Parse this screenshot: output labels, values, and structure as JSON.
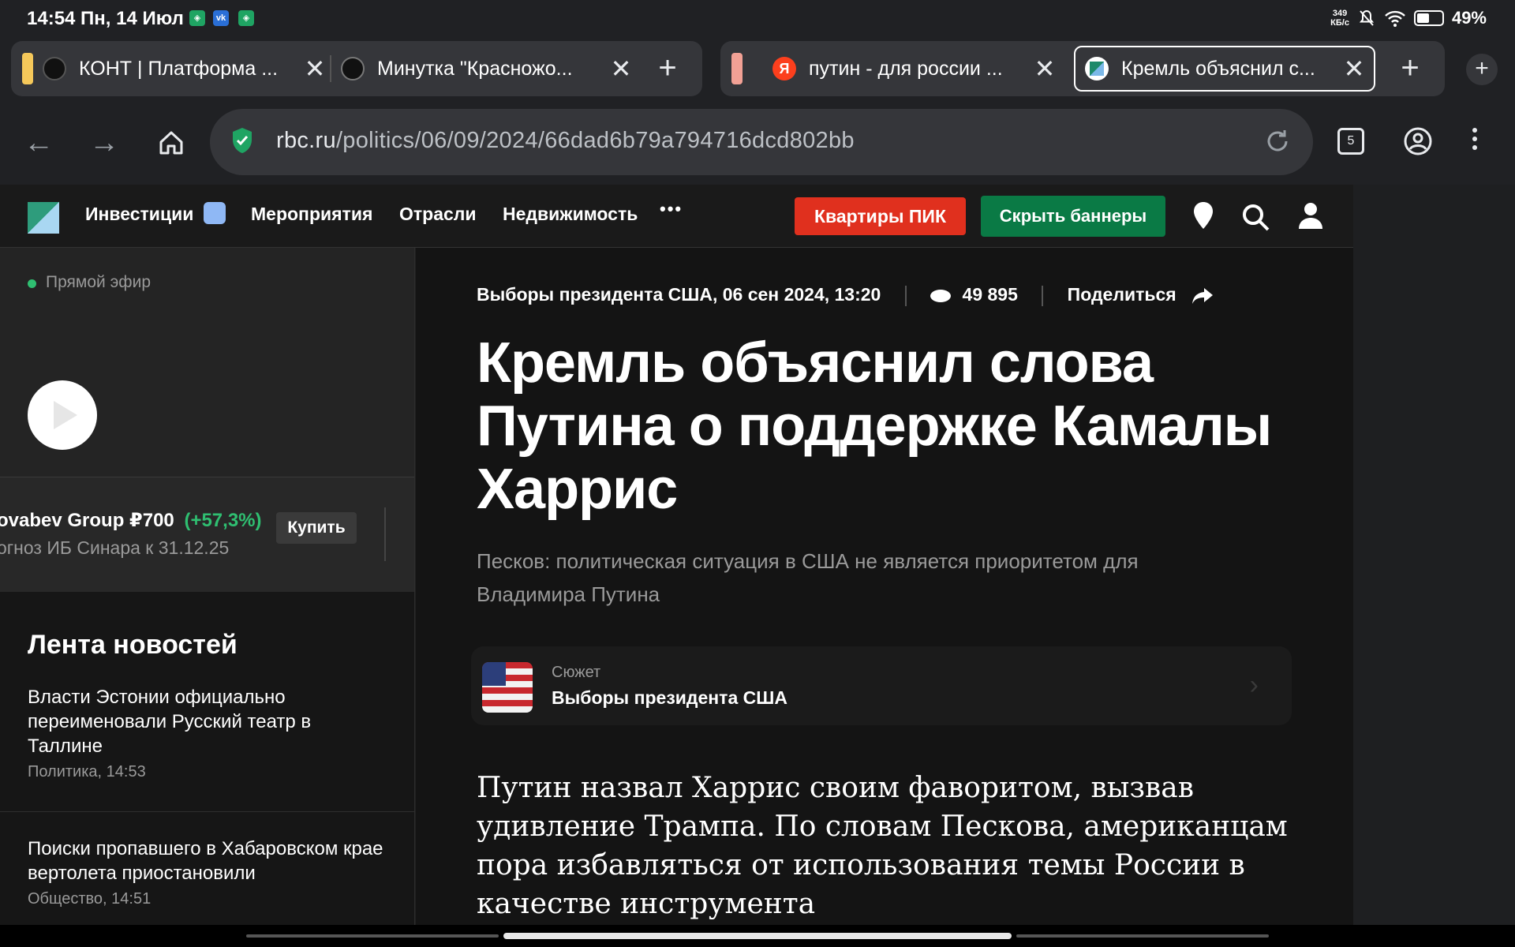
{
  "status_bar": {
    "time": "14:54 Пн, 14 Июл",
    "net_speed_value": "349",
    "net_speed_unit": "КБ/с",
    "battery": "49%",
    "battery_level": 0.49,
    "app_icons": [
      "shield-app-icon",
      "vk-icon",
      "shield-app-icon"
    ]
  },
  "tabs": {
    "group1": [
      {
        "title": "КОНТ | Платформа ..."
      },
      {
        "title": "Минутка \"Красножо..."
      }
    ],
    "group2": [
      {
        "title": "путин - для россии ...",
        "favicon_text": "Я"
      },
      {
        "title": "Кремль объяснил с...",
        "active": true
      }
    ]
  },
  "toolbar": {
    "url_host": "rbc.ru",
    "url_path": "/politics/06/09/2024/66dad6b79a794716dcd802bb",
    "tab_count": "5"
  },
  "site_nav": {
    "items": [
      "Инвестиции",
      "Мероприятия",
      "Отрасли",
      "Недвижимость"
    ],
    "more": "•••",
    "btn_pik": "Квартиры ПИК",
    "btn_hide_banners": "Скрыть баннеры"
  },
  "sidebar": {
    "live_label": "Прямой эфир",
    "ticker": {
      "name": "ovabev Group ₽700",
      "change": "(+57,3%)",
      "note": "огноз ИБ Синара к 31.12.25",
      "buy": "Купить"
    },
    "feed_title": "Лента новостей",
    "news": [
      {
        "headline": "Власти Эстонии официально переименовали Русский театр в Таллине",
        "meta": "Политика, 14:53"
      },
      {
        "headline": "Поиски пропавшего в Хабаровском крае вертолета приостановили",
        "meta": "Общество, 14:51"
      }
    ]
  },
  "article": {
    "rubric_date": "Выборы президента США, 06 сен 2024, 13:20",
    "views": "49 895",
    "share": "Поделиться",
    "title": "Кремль объяснил слова Путина о поддержке Камалы Харрис",
    "lead": "Песков: политическая ситуация в США не является приоритетом для Владимира Путина",
    "story_label": "Сюжет",
    "story_title": "Выборы президента США",
    "body": "Путин назвал Харрис своим фаворитом, вызвав удивление Трампа. По словам Пескова, американцам пора избавляться от использования темы России в качестве инструмента"
  },
  "colors": {
    "accent_red": "#e0301e",
    "accent_green": "#0a7a45",
    "positive": "#2fbf71"
  }
}
